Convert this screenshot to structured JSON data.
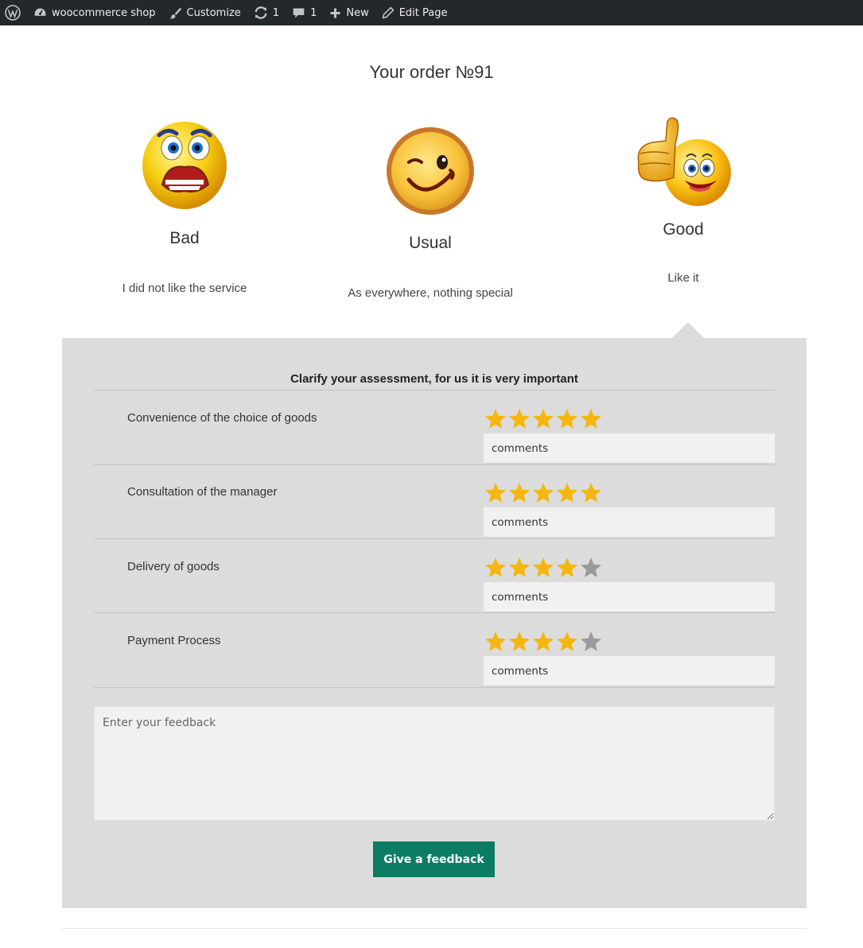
{
  "adminbar": {
    "site_name": "woocommerce shop",
    "customize": "Customize",
    "updates_count": "1",
    "comments_count": "1",
    "new_label": "New",
    "edit_label": "Edit Page"
  },
  "page": {
    "title": "Your order №91"
  },
  "moods": [
    {
      "label": "Bad",
      "description": "I did not like the service"
    },
    {
      "label": "Usual",
      "description": "As everywhere, nothing special"
    },
    {
      "label": "Good",
      "description": "Like it",
      "selected": true
    }
  ],
  "assessment": {
    "heading": "Clarify your assessment, for us it is very important",
    "criteria": [
      {
        "label": "Convenience of the choice of goods",
        "rating": 5,
        "max": 5,
        "comment_placeholder": "comments"
      },
      {
        "label": "Consultation of the manager",
        "rating": 5,
        "max": 5,
        "comment_placeholder": "comments"
      },
      {
        "label": "Delivery of goods",
        "rating": 4,
        "max": 5,
        "comment_placeholder": "comments"
      },
      {
        "label": "Payment Process",
        "rating": 4,
        "max": 5,
        "comment_placeholder": "comments"
      }
    ],
    "feedback_placeholder": "Enter your feedback",
    "submit_label": "Give a feedback"
  },
  "colors": {
    "star_filled": "#f5b70d",
    "star_empty": "#9a9a9a",
    "button": "#0c7d64",
    "panel": "#dcdcdc",
    "adminbar": "#23282d"
  }
}
